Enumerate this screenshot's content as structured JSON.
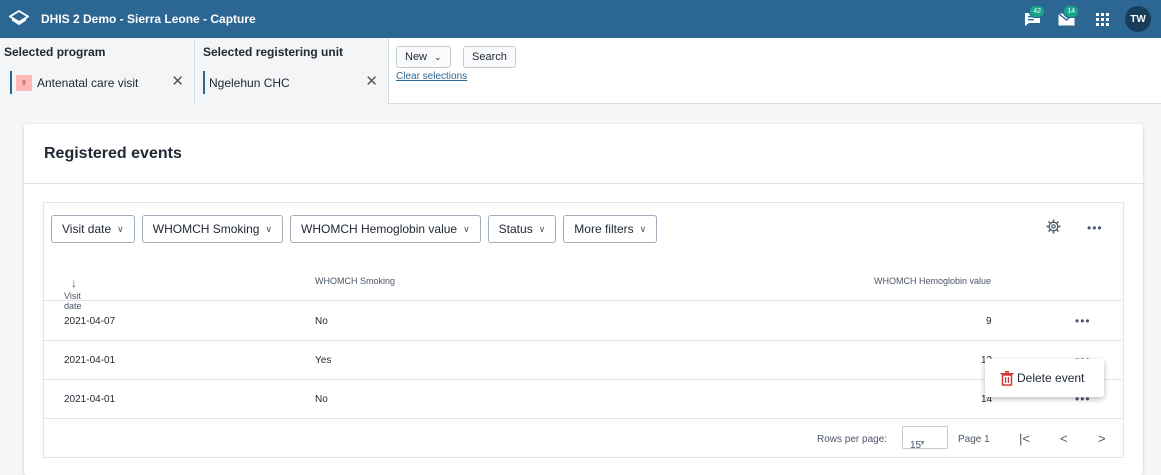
{
  "header": {
    "app_title": "DHIS 2 Demo - Sierra Leone - Capture",
    "messages_badge": "42",
    "email_badge": "14",
    "avatar_initials": "TW",
    "bg_color": "#2c6693"
  },
  "selection": {
    "program_title": "Selected program",
    "program_value": "Antenatal care visit",
    "org_title": "Selected registering unit",
    "org_value": "Ngelehun CHC",
    "new_label": "New",
    "search_label": "Search",
    "clear_label": "Clear selections"
  },
  "card": {
    "title": "Registered events",
    "filters": [
      "Visit date",
      "WHOMCH Smoking",
      "WHOMCH Hemoglobin value",
      "Status",
      "More filters"
    ],
    "columns": [
      "Visit date",
      "WHOMCH Smoking",
      "WHOMCH Hemoglobin value"
    ],
    "rows": [
      {
        "date": "2021-04-07",
        "smoking": "No",
        "hb": "9"
      },
      {
        "date": "2021-04-01",
        "smoking": "Yes",
        "hb": "12"
      },
      {
        "date": "2021-04-01",
        "smoking": "No",
        "hb": "14"
      }
    ],
    "pagination": {
      "rows_per_page_label": "Rows per page:",
      "rows_per_page_value": "15",
      "page_label": "Page 1"
    }
  },
  "context_menu": {
    "delete_label": "Delete event"
  }
}
